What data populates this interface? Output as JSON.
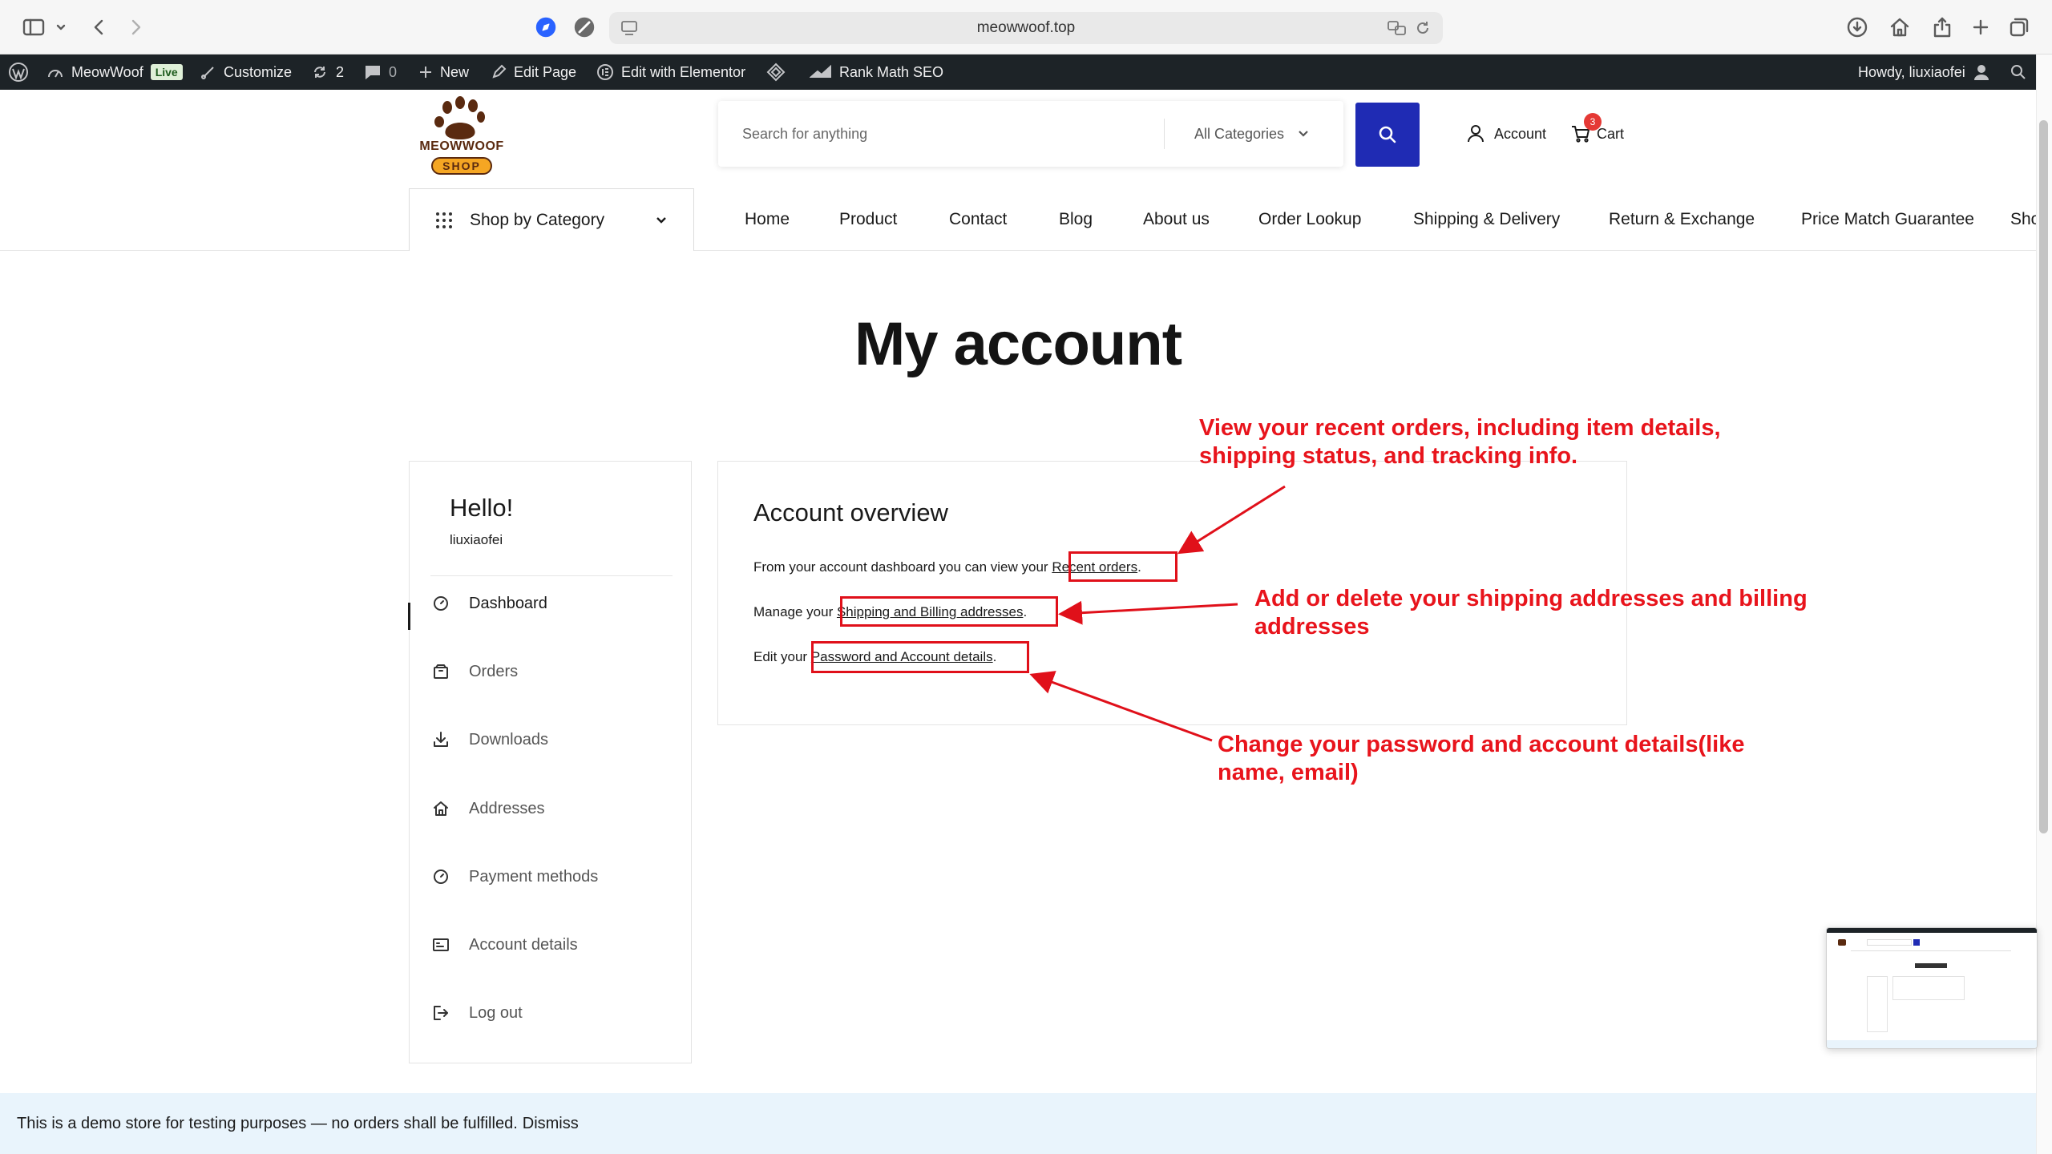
{
  "browser": {
    "url": "meowwoof.top"
  },
  "admin_bar": {
    "site_name": "MeowWoof",
    "live_badge": "Live",
    "customize": "Customize",
    "updates_count": "2",
    "comments_count": "0",
    "new": "New",
    "edit_page": "Edit Page",
    "edit_elementor": "Edit with Elementor",
    "rank_math": "Rank Math SEO",
    "howdy": "Howdy, liuxiaofei"
  },
  "header": {
    "logo_top": "MEOWWOOF",
    "logo_bottom": "SHOP",
    "search_placeholder": "Search for anything",
    "category_select": "All Categories",
    "account_label": "Account",
    "cart_label": "Cart",
    "cart_count": "3"
  },
  "nav": {
    "shop_by_category": "Shop by Category",
    "items": [
      "Home",
      "Product",
      "Contact",
      "Blog",
      "About us",
      "Order Lookup",
      "Shipping & Delivery",
      "Return & Exchange",
      "Price Match Guarantee",
      "Sho"
    ]
  },
  "page": {
    "title": "My account"
  },
  "sidebar": {
    "hello": "Hello!",
    "username": "liuxiaofei",
    "items": [
      {
        "label": "Dashboard",
        "icon": "dashboard-gauge-icon"
      },
      {
        "label": "Orders",
        "icon": "orders-box-icon"
      },
      {
        "label": "Downloads",
        "icon": "download-icon"
      },
      {
        "label": "Addresses",
        "icon": "home-icon"
      },
      {
        "label": "Payment methods",
        "icon": "payment-gauge-icon"
      },
      {
        "label": "Account details",
        "icon": "id-card-icon"
      },
      {
        "label": "Log out",
        "icon": "logout-icon"
      }
    ]
  },
  "overview": {
    "title": "Account overview",
    "line1_prefix": "From your account dashboard you can view your ",
    "line1_link": "Recent orders",
    "line2_prefix": "Manage your ",
    "line2_link": "Shipping and Billing addresses",
    "line3_prefix": "Edit your ",
    "line3_link": "Password and Account details",
    "period": "."
  },
  "annotations": {
    "orders_line1": "View your recent orders, including item details,",
    "orders_line2": "shipping status, and tracking info.",
    "addresses_line1": "Add or delete your shipping addresses and billing",
    "addresses_line2": "addresses",
    "password_line1": "Change your password and account details(like",
    "password_line2": "name, email)",
    "color": "#e8141c"
  },
  "notice": {
    "text": "This is a demo store for testing purposes — no orders shall be fulfilled.",
    "dismiss": "Dismiss"
  },
  "colors": {
    "search_button": "#1f2bb4",
    "admin_bar": "#1d2327",
    "notice_bg": "#e9f4fc",
    "cart_badge": "#e53935"
  }
}
